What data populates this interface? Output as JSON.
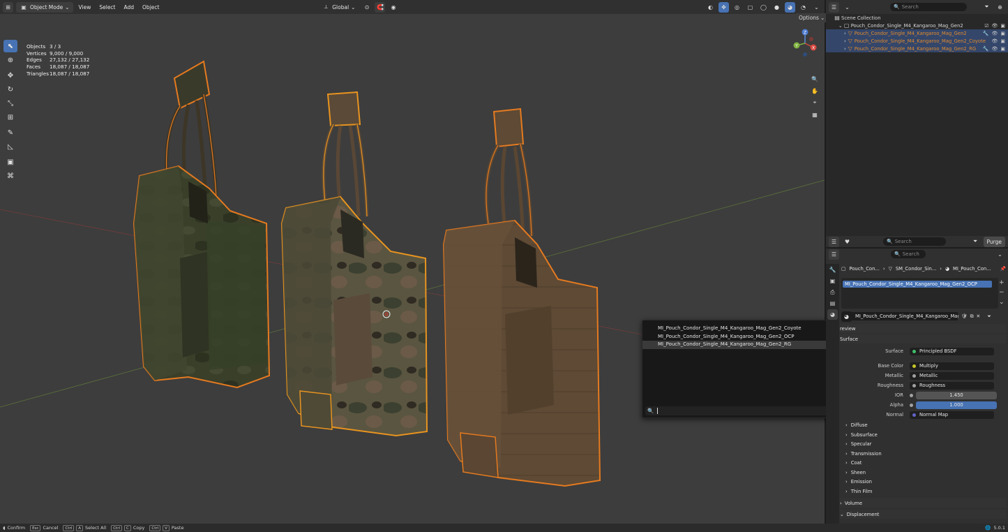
{
  "header": {
    "mode": "Object Mode",
    "menus": [
      "View",
      "Select",
      "Add",
      "Object"
    ],
    "transform_orientation": "Global",
    "options_label": "Options"
  },
  "stats": [
    {
      "label": "Objects",
      "value": "3 / 3"
    },
    {
      "label": "Vertices",
      "value": "9,000 / 9,000"
    },
    {
      "label": "Edges",
      "value": "27,132 / 27,132"
    },
    {
      "label": "Faces",
      "value": "18,087 / 18,087"
    },
    {
      "label": "Triangles",
      "value": "18,087 / 18,087"
    }
  ],
  "gizmo": {
    "x": "X",
    "y": "Y",
    "z": "Z"
  },
  "popup": {
    "items": [
      "MI_Pouch_Condor_Single_M4_Kangaroo_Mag_Gen2_Coyote",
      "MI_Pouch_Condor_Single_M4_Kangaroo_Mag_Gen2_OCP",
      "MI_Pouch_Condor_Single_M4_Kangaroo_Mag_Gen2_RG"
    ],
    "highlighted_index": 2
  },
  "outliner": {
    "search_placeholder": "Search",
    "scene_collection": "Scene Collection",
    "collection": "Pouch_Condor_Single_M4_Kangaroo_Mag_Gen2",
    "objects": [
      "Pouch_Condor_Single_M4_Kangaroo_Mag_Gen2",
      "Pouch_Condor_Single_M4_Kangaroo_Mag_Gen2_Coyote",
      "Pouch_Condor_Single_M4_Kangaroo_Mag_Gen2_RG"
    ],
    "purge_label": "Purge",
    "search2_placeholder": "Search"
  },
  "properties": {
    "search_placeholder": "Search",
    "breadcrumb": [
      "Pouch_Con...",
      "SM_Condor_Sin...",
      "MI_Pouch_Con..."
    ],
    "slot": "MI_Pouch_Condor_Single_M4_Kangaroo_Mag_Gen2_OCP",
    "material_name": "MI_Pouch_Condor_Single_M4_Kangaroo_Mag_Ge...",
    "preview_label": "review",
    "surface_section": "Surface",
    "rows": [
      {
        "label": "Surface",
        "value": "Principled BSDF",
        "dot": "#3fbf6a"
      },
      {
        "label": "Base Color",
        "value": "Multiply",
        "dot": "#c7c729"
      },
      {
        "label": "Metallic",
        "value": "Metallic",
        "dot": "#a1a1a1"
      },
      {
        "label": "Roughness",
        "value": "Roughness",
        "dot": "#a1a1a1"
      },
      {
        "label": "IOR",
        "value": "1.450",
        "dot": "#a1a1a1"
      },
      {
        "label": "Alpha",
        "value": "1.000",
        "dot": "#a1a1a1"
      },
      {
        "label": "Normal",
        "value": "Normal Map",
        "dot": "#6363c7"
      }
    ],
    "subpanels": [
      "Diffuse",
      "Subsurface",
      "Specular",
      "Transmission",
      "Coat",
      "Sheen",
      "Emission",
      "Thin Film"
    ],
    "volume_label": "Volume",
    "displacement_label": "Displacement"
  },
  "statusbar": {
    "confirm": "Confirm",
    "cancel_key": "Esc",
    "cancel": "Cancel",
    "ctrl_key": "Ctrl",
    "a_key": "A",
    "select_all": "Select All",
    "c_key": "C",
    "copy": "Copy",
    "v_key": "V",
    "paste": "Paste",
    "version": "5.0.1"
  },
  "colors": {
    "selection_orange": "#e57a1f",
    "active_blue": "#4772b3",
    "viewport_bg": "#3d3d3d"
  }
}
